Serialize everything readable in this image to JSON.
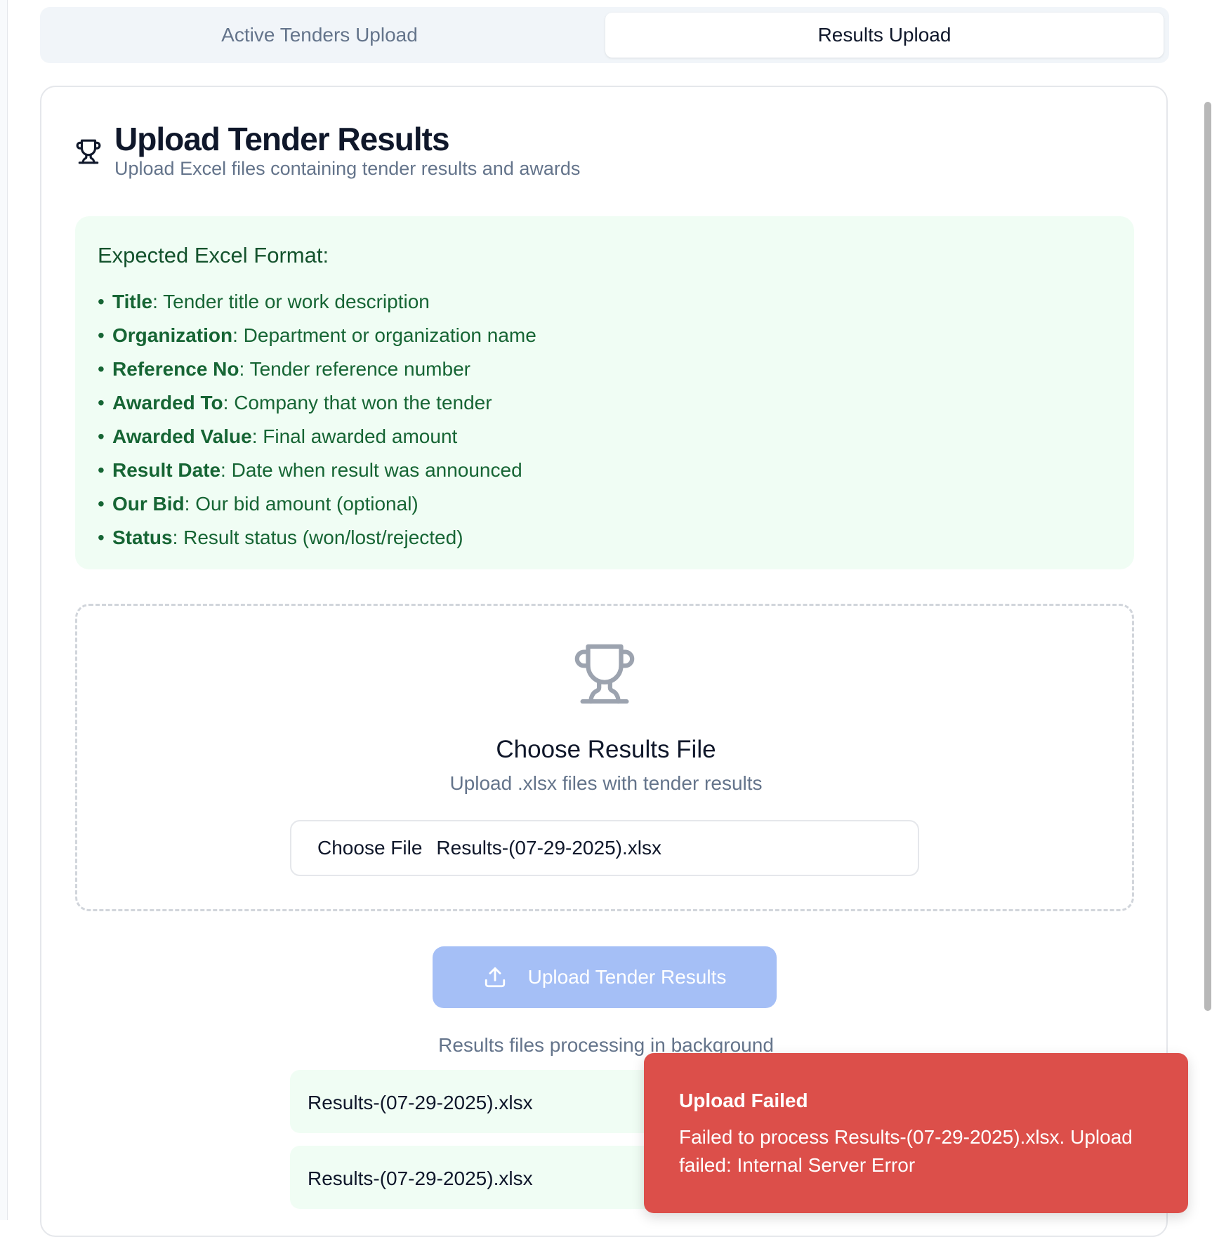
{
  "tabs": {
    "active_tenders_label": "Active Tenders Upload",
    "results_label": "Results Upload"
  },
  "header": {
    "icon": "trophy-icon",
    "title": "Upload Tender Results",
    "subtitle": "Upload Excel files containing tender results and awards"
  },
  "format": {
    "title": "Expected Excel Format:",
    "fields": [
      {
        "name": "Title",
        "desc": ": Tender title or work description"
      },
      {
        "name": "Organization",
        "desc": ": Department or organization name"
      },
      {
        "name": "Reference No",
        "desc": ": Tender reference number"
      },
      {
        "name": "Awarded To",
        "desc": ": Company that won the tender"
      },
      {
        "name": "Awarded Value",
        "desc": ": Final awarded amount"
      },
      {
        "name": "Result Date",
        "desc": ": Date when result was announced"
      },
      {
        "name": "Our Bid",
        "desc": ": Our bid amount (optional)"
      },
      {
        "name": "Status",
        "desc": ": Result status (won/lost/rejected)"
      }
    ]
  },
  "dropzone": {
    "icon": "trophy-icon",
    "title": "Choose Results File",
    "subtitle": "Upload .xlsx files with tender results",
    "choose_button": "Choose File",
    "file_name": "Results-(07-29-2025).xlsx"
  },
  "upload_button": {
    "icon": "upload-icon",
    "label": "Upload Tender Results"
  },
  "processing": {
    "label": "Results files processing in background",
    "files": [
      "Results-(07-29-2025).xlsx",
      "Results-(07-29-2025).xlsx"
    ]
  },
  "toast": {
    "title": "Upload Failed",
    "message": "Failed to process Results-(07-29-2025).xlsx. Upload failed: Internal Server Error"
  },
  "colors": {
    "format_bg": "#f0fdf4",
    "format_text": "#166534",
    "upload_button_bg": "#a5bff6",
    "toast_bg": "#dc4f4a"
  }
}
